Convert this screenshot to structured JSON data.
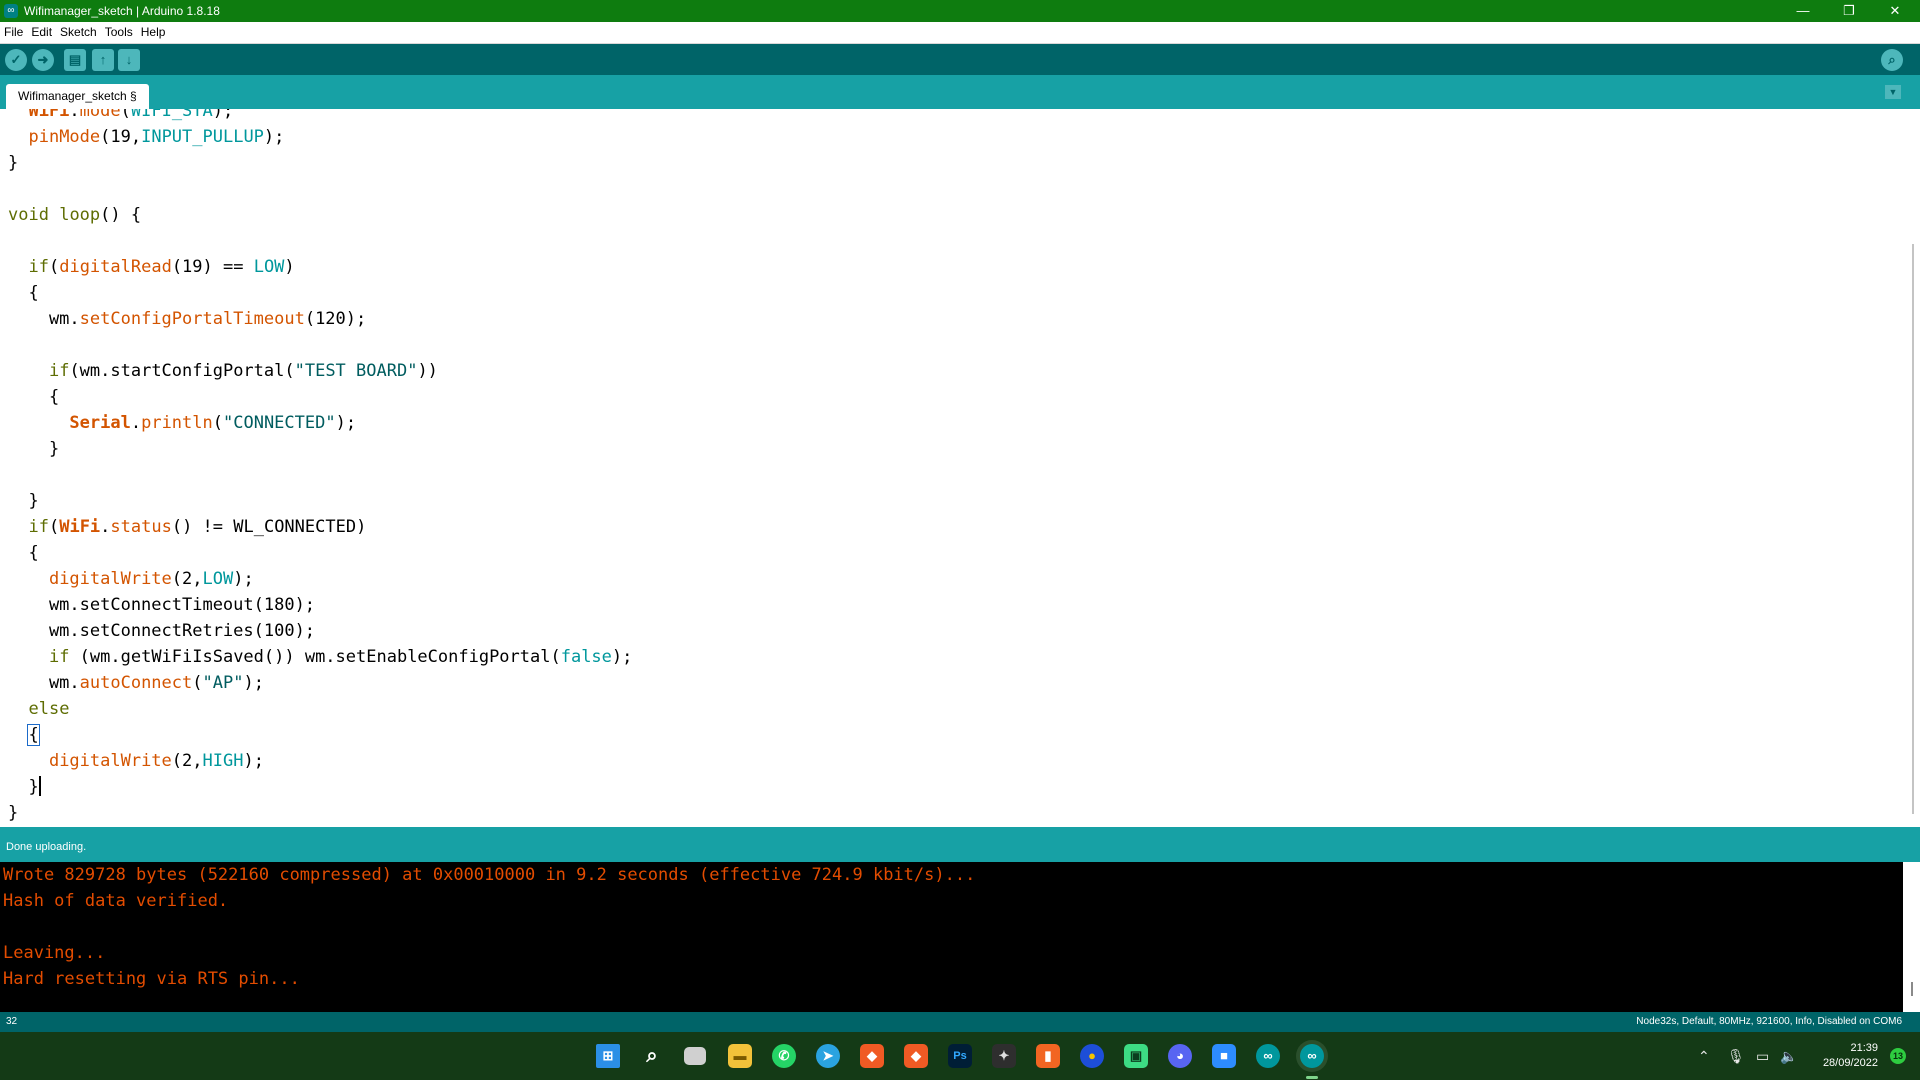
{
  "window": {
    "title": "Wifimanager_sketch | Arduino 1.8.18",
    "app_icon": "arduino-logo-icon",
    "controls": {
      "minimize": "—",
      "maximize": "❐",
      "close": "✕"
    }
  },
  "menu": [
    "File",
    "Edit",
    "Sketch",
    "Tools",
    "Help"
  ],
  "toolbar": {
    "verify": "✓",
    "upload": "➜",
    "new": "▤",
    "open": "↑",
    "save": "↓",
    "serial_monitor": "⌕"
  },
  "tabs": [
    {
      "label": "Wifimanager_sketch §"
    }
  ],
  "tab_menu": "▼",
  "editor": {
    "lines": [
      "  WiFi.mode(WIFI_STA);",
      "  pinMode(19,INPUT_PULLUP);",
      "}",
      "",
      "void loop() {",
      "",
      "  if(digitalRead(19) == LOW)",
      "  {",
      "    wm.setConfigPortalTimeout(120);",
      "",
      "    if(wm.startConfigPortal(\"TEST BOARD\"))",
      "    {",
      "      Serial.println(\"CONNECTED\");",
      "    }",
      "",
      "  }",
      "  if(WiFi.status() != WL_CONNECTED)",
      "  {",
      "    digitalWrite(2,LOW);",
      "    wm.setConnectTimeout(180);",
      "    wm.setConnectRetries(100);",
      "    if (wm.getWiFiIsSaved()) wm.setEnableConfigPortal(false);",
      "    wm.autoConnect(\"AP\");",
      "  else",
      "  {",
      "    digitalWrite(2,HIGH);",
      "  }",
      "}"
    ]
  },
  "status_message": "Done uploading.",
  "console": {
    "lines": [
      "Wrote 829728 bytes (522160 compressed) at 0x00010000 in 9.2 seconds (effective 724.9 kbit/s)...",
      "Hash of data verified.",
      "",
      "Leaving...",
      "Hard resetting via RTS pin..."
    ]
  },
  "bottom_status": {
    "line_number": "32",
    "board": "Node32s, Default, 80MHz, 921600, Info, Disabled on COM6"
  },
  "taskbar": {
    "apps": [
      "start-icon",
      "search-icon",
      "task-view-icon",
      "file-explorer-icon",
      "whatsapp-icon",
      "telegram-icon",
      "brave-beta-icon",
      "brave-icon",
      "photoshop-icon",
      "davinci-resolve-icon",
      "app-orange-icon",
      "app-blue-yellow-icon",
      "android-studio-icon",
      "discord-icon",
      "zoom-icon",
      "arduino-icon",
      "arduino-ide-icon"
    ],
    "time": "21:39",
    "date": "28/09/2022",
    "notifications": "13"
  },
  "colors": {
    "titlebar": "#0e7c0f",
    "toolbar": "#006468",
    "tabbar": "#17a1a5",
    "console_text": "#e34c00",
    "taskbar": "#143a16"
  }
}
